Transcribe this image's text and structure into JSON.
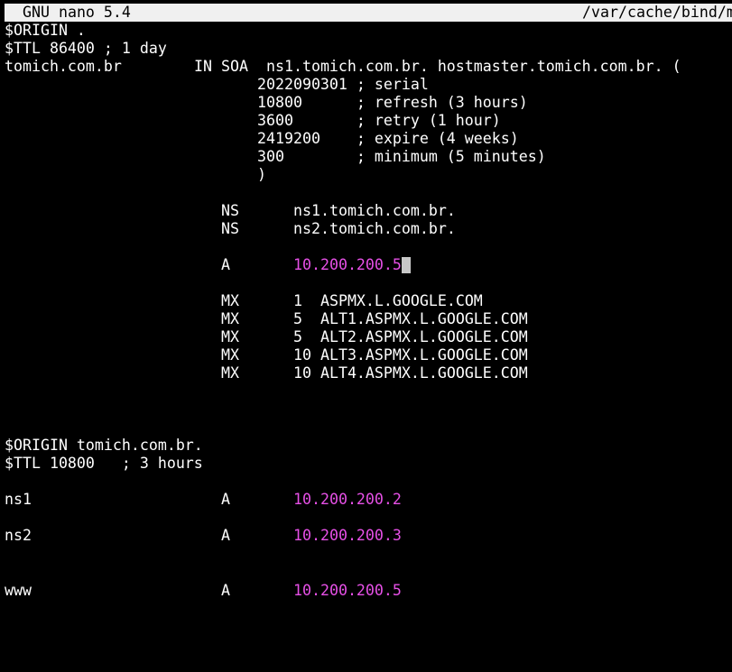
{
  "titlebar": {
    "app": "GNU nano 5.4",
    "file": "/var/cache/bind/m"
  },
  "zone": {
    "origin1": "$ORIGIN .",
    "ttl1": "$TTL 86400 ; 1 day",
    "soa": {
      "name": "tomich.com.br",
      "class_type": "IN SOA",
      "mname_rname": "ns1.tomich.com.br. hostmaster.tomich.com.br. (",
      "serial": "2022090301 ; serial",
      "refresh": "10800      ; refresh (3 hours)",
      "retry": "3600       ; retry (1 hour)",
      "expire": "2419200    ; expire (4 weeks)",
      "minimum": "300        ; minimum (5 minutes)",
      "close": ")"
    },
    "ns_records": [
      {
        "type": "NS",
        "value": "ns1.tomich.com.br."
      },
      {
        "type": "NS",
        "value": "ns2.tomich.com.br."
      }
    ],
    "a_root": {
      "type": "A",
      "value": "10.200.200.5"
    },
    "mx_records": [
      {
        "type": "MX",
        "value": "1  ASPMX.L.GOOGLE.COM"
      },
      {
        "type": "MX",
        "value": "5  ALT1.ASPMX.L.GOOGLE.COM"
      },
      {
        "type": "MX",
        "value": "5  ALT2.ASPMX.L.GOOGLE.COM"
      },
      {
        "type": "MX",
        "value": "10 ALT3.ASPMX.L.GOOGLE.COM"
      },
      {
        "type": "MX",
        "value": "10 ALT4.ASPMX.L.GOOGLE.COM"
      }
    ],
    "origin2": "$ORIGIN tomich.com.br.",
    "ttl2": "$TTL 10800   ; 3 hours",
    "hosts": [
      {
        "name": "ns1",
        "type": "A",
        "value": "10.200.200.2"
      },
      {
        "name": "ns2",
        "type": "A",
        "value": "10.200.200.3"
      },
      {
        "name": "www",
        "type": "A",
        "value": "10.200.200.5"
      }
    ]
  },
  "colors": {
    "background": "#000000",
    "text": "#ffffff",
    "ip_address": "#e650e6",
    "titlebar_bg": "#f0f0f0",
    "cursor": "#c8c8c8"
  }
}
